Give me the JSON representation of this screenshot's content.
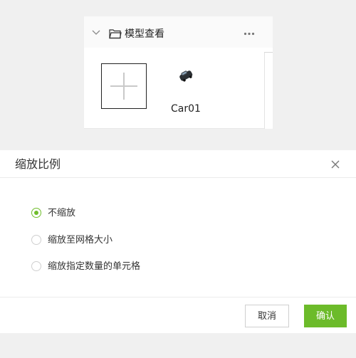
{
  "model_panel": {
    "title": "模型查看",
    "icons": {
      "collapse": "chevron-down-icon",
      "folder": "folder-icon",
      "more": "more-dots-icon",
      "add": "plus-icon",
      "model": "car-model-icon"
    },
    "items": [
      {
        "label": "Car01"
      }
    ]
  },
  "scale_dialog": {
    "title": "缩放比例",
    "close_icon": "close-icon",
    "options": [
      {
        "label": "不缩放",
        "selected": true
      },
      {
        "label": "缩放至网格大小",
        "selected": false
      },
      {
        "label": "缩放指定数量的单元格",
        "selected": false
      }
    ],
    "buttons": {
      "cancel": "取消",
      "confirm": "确认"
    }
  },
  "colors": {
    "accent": "#6cbb2a",
    "page_background": "#f0f0f0"
  }
}
